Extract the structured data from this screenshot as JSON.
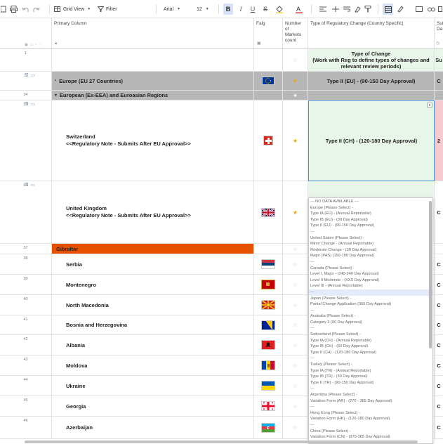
{
  "toolbar": {
    "view_label": "Grid View",
    "filter_label": "Filter",
    "font_value": "Arial",
    "size_value": "12"
  },
  "columns": {
    "primary": "Primary Column",
    "flag": "Falg",
    "number_of_markets": "Number of Markets count",
    "type_of_change": "Type of Regulatory Change (Country Specific)",
    "submission_partial": "Sub Da"
  },
  "rows": [
    {
      "num": "1",
      "label": "",
      "type_text": "Type of Change\n(Work with Reg to define types of changes and relevant review periods)",
      "extra": "Su"
    },
    {
      "num": "3",
      "label": "Europe (EU 27 Countries)",
      "type_text": "Type II (EU) - (90-150 Day Approval)",
      "extra": "C"
    },
    {
      "num": "34",
      "label": "European (Ex-EEA) and Euroasian Regions",
      "type_text": "",
      "extra": ""
    },
    {
      "num": "35",
      "label": "Switzerland\n<<Regulatory Note - Submits After EU Approval>>",
      "type_text": "Type II (CH) - (120-180 Day Approval)",
      "extra": "2"
    },
    {
      "num": "36",
      "label": "United Kingdom\n<<Regulatory Note - Submits After EU Approval>>",
      "type_text": "",
      "extra": "C"
    },
    {
      "num": "37",
      "label": "Gibraltar",
      "type_text": "",
      "extra": ""
    },
    {
      "num": "38",
      "label": "Serbia",
      "type_text": "",
      "extra": "C"
    },
    {
      "num": "39",
      "label": "Montenegro",
      "type_text": "",
      "extra": "C"
    },
    {
      "num": "40",
      "label": "North Macedonia",
      "type_text": "",
      "extra": "C"
    },
    {
      "num": "41",
      "label": "Bosnia and Herzegovina",
      "type_text": "",
      "extra": "C"
    },
    {
      "num": "42",
      "label": "Albania",
      "type_text": "",
      "extra": "C"
    },
    {
      "num": "43",
      "label": "Moldova",
      "type_text": "",
      "extra": "C"
    },
    {
      "num": "44",
      "label": "Ukraine",
      "type_text": "",
      "extra": "C"
    },
    {
      "num": "45",
      "label": "Georgia",
      "type_text": "",
      "extra": "C"
    },
    {
      "num": "46",
      "label": "Azerbaijan",
      "type_text": "",
      "extra": "C"
    }
  ],
  "dropdown_options": [
    "--- NO DATA AVAILABLE ---",
    "Europe (Please Select) -",
    "Type IA (EU) - (Annual Reportable)",
    "Type IB (EU) - (30 Day Approval)",
    "Type II (EU) - (90-150 Day Approval)",
    "---",
    "United States (Please Select) -",
    "Minor Change - (Annual Reportable)",
    "Moderate Change - (30 Day Approval)",
    "Major (PAS) (150-180 Day Approval)",
    "---",
    "Canada (Please Select) -",
    "Level I, Major - (240-240 Day Approval)",
    "Level II Moderate - (XXX Day Approval)",
    "Level III - (Annual Reportable)",
    "---",
    "Japan (Please Select) -",
    "Partial Change Application (365 Day Approval)",
    "---",
    "Australia (Please Select) -",
    "Category 3 (90 Day Approval)",
    "---",
    "Switzerland (Please Select) -",
    "Type IA (CH) - (Annual Reportable)",
    "Type IB (CH) - (60 Day Approval)",
    "Type II (CH) - (120-180 Day Approval)",
    "---",
    "Turkey (Please Select) -",
    "Type IA (TR) - (Annual Reportable)",
    "Type IB (TR) - (30 Day Approval)",
    "Type II (TR) - (90-150 Day Approval)",
    "---",
    "Argentina (Please Select) -",
    "Variation Form (AR) - (270 - 365 Day Approval)",
    "---",
    "Hong Kong (Please Select) -",
    "Variation Form (HK) - (120-180 Day Approval)",
    "---",
    "China (Please Select) -",
    "Variation Form (CN) - (270-365 Day Approval)"
  ],
  "colors": {
    "accent": "#d6e2f5",
    "group_row": "#b7b7b7",
    "gibraltar_row": "#e65100",
    "type_column_bg": "#e8f5e9",
    "selected_border": "#4a90d9",
    "star": "#f0a500",
    "pink_partial": "#f7c9d0"
  }
}
